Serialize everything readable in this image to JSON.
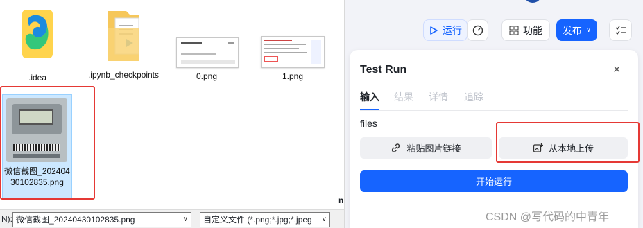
{
  "file_dialog": {
    "items": [
      {
        "name": ".idea"
      },
      {
        "name": ".ipynb_checkpoints"
      },
      {
        "name": "0.png"
      },
      {
        "name": "1.png"
      },
      {
        "name": "微信截图_20240430102835.png"
      }
    ],
    "filename_label": "N):",
    "filename_value": "微信截图_20240430102835.png",
    "filter_value": "自定义文件 (*.png;*.jpg;*.jpeg",
    "side_char": "n"
  },
  "toolbar": {
    "run_label": "运行",
    "feature_label": "功能",
    "publish_label": "发布"
  },
  "test_run": {
    "title": "Test Run",
    "tabs": [
      "输入",
      "结果",
      "详情",
      "追踪"
    ],
    "field_label": "files",
    "paste_link_label": "粘贴图片链接",
    "upload_local_label": "从本地上传",
    "start_label": "开始运行"
  },
  "watermark": "CSDN @写代码的中青年",
  "colors": {
    "accent": "#1664ff",
    "highlight": "#e53935",
    "folder": "#f6c75a"
  }
}
